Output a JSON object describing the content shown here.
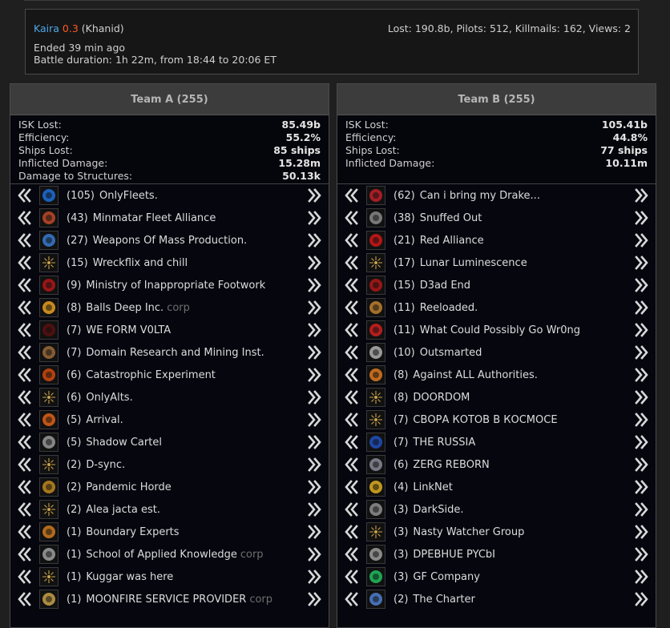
{
  "battle": {
    "system": "Kaira",
    "security": "0.3",
    "region": "(Khanid)",
    "stats": "Lost: 190.8b, Pilots: 512, Killmails: 162, Views: 2",
    "ended": "Ended 39 min ago",
    "duration": "Battle duration: 1h 22m,  from 18:44 to 20:06 ET"
  },
  "teams": [
    {
      "title": "Team A (255)",
      "stats": [
        {
          "label": "ISK Lost:",
          "value": "85.49b"
        },
        {
          "label": "Efficiency:",
          "value": "55.2%"
        },
        {
          "label": "Ships Lost:",
          "value": "85 ships"
        },
        {
          "label": "Inflicted Damage:",
          "value": "15.28m"
        },
        {
          "label": "Damage to Structures:",
          "value": "50.13k"
        }
      ],
      "alliances": [
        {
          "count": "(105)",
          "name": "OnlyFleets.",
          "icon": "onlyfleets-logo",
          "color": "#1e6fd9"
        },
        {
          "count": "(43)",
          "name": "Minmatar Fleet Alliance",
          "icon": "minmatar-logo",
          "color": "#c0492a"
        },
        {
          "count": "(27)",
          "name": "Weapons Of Mass Production.",
          "icon": "wmp-logo",
          "color": "#3a7bd0"
        },
        {
          "count": "(15)",
          "name": "Wreckflix and chill",
          "icon": "default-star-logo",
          "color": "#c9a24a"
        },
        {
          "count": "(9)",
          "name": "Ministry of Inappropriate Footwork",
          "icon": "ministry-logo",
          "color": "#b01818"
        },
        {
          "count": "(8)",
          "name": "Balls Deep Inc.",
          "corp": "corp",
          "icon": "scorpion-logo",
          "color": "#e8a020"
        },
        {
          "count": "(7)",
          "name": "WE FORM V0LTA",
          "icon": "volta-logo",
          "color": "#5a1010"
        },
        {
          "count": "(7)",
          "name": "Domain Research and Mining Inst.",
          "icon": "amarr-logo",
          "color": "#9a6a3a"
        },
        {
          "count": "(6)",
          "name": "Catastrophic Experiment",
          "icon": "catastrophic-logo",
          "color": "#d04a10"
        },
        {
          "count": "(6)",
          "name": "OnlyAlts.",
          "icon": "default-star-logo",
          "color": "#c9a24a"
        },
        {
          "count": "(5)",
          "name": "Arrival.",
          "icon": "arrival-logo",
          "color": "#e0601a"
        },
        {
          "count": "(5)",
          "name": "Shadow Cartel",
          "icon": "shadow-logo",
          "color": "#9a9a9a"
        },
        {
          "count": "(2)",
          "name": "D-sync.",
          "icon": "default-star-logo",
          "color": "#c9a24a"
        },
        {
          "count": "(2)",
          "name": "Pandemic Horde",
          "icon": "horde-logo",
          "color": "#c08a20"
        },
        {
          "count": "(2)",
          "name": "Alea jacta est.",
          "icon": "default-star-logo",
          "color": "#c9a24a"
        },
        {
          "count": "(1)",
          "name": "Boundary Experts",
          "icon": "boundary-logo",
          "color": "#d07a20"
        },
        {
          "count": "(1)",
          "name": "School of Applied Knowledge",
          "corp": "corp",
          "icon": "school-logo",
          "color": "#a0a0a0"
        },
        {
          "count": "(1)",
          "name": "Kuggar was here",
          "icon": "default-star-logo",
          "color": "#c9a24a"
        },
        {
          "count": "(1)",
          "name": "MOONFIRE SERVICE PROVIDER",
          "corp": "corp",
          "icon": "moonfire-logo",
          "color": "#c9a24a"
        }
      ]
    },
    {
      "title": "Team B (255)",
      "stats": [
        {
          "label": "ISK Lost:",
          "value": "105.41b"
        },
        {
          "label": "Efficiency:",
          "value": "44.8%"
        },
        {
          "label": "Ships Lost:",
          "value": "77 ships"
        },
        {
          "label": "Inflicted Damage:",
          "value": "10.11m"
        }
      ],
      "alliances": [
        {
          "count": "(62)",
          "name": "Can i bring my Drake...",
          "icon": "drake-logo",
          "color": "#c0202a"
        },
        {
          "count": "(38)",
          "name": "Snuffed Out",
          "icon": "snuffed-logo",
          "color": "#8a8a8a"
        },
        {
          "count": "(21)",
          "name": "Red Alliance",
          "icon": "red-alliance-logo",
          "color": "#d01818"
        },
        {
          "count": "(17)",
          "name": "Lunar Luminescence",
          "icon": "default-star-logo",
          "color": "#c9a24a"
        },
        {
          "count": "(15)",
          "name": "D3ad End",
          "icon": "d3ad-logo",
          "color": "#b01818"
        },
        {
          "count": "(11)",
          "name": "Reeloaded.",
          "icon": "reeloaded-logo",
          "color": "#c08030"
        },
        {
          "count": "(11)",
          "name": "What Could Possibly Go Wr0ng",
          "icon": "wcpgw-logo",
          "color": "#d02020"
        },
        {
          "count": "(10)",
          "name": "Outsmarted",
          "icon": "outsmarted-logo",
          "color": "#b0b0b0"
        },
        {
          "count": "(8)",
          "name": "Against ALL Authorities.",
          "icon": "aaa-logo",
          "color": "#e07a20"
        },
        {
          "count": "(8)",
          "name": "DOORDOM",
          "icon": "default-star-logo",
          "color": "#c9a24a"
        },
        {
          "count": "(7)",
          "name": "СВОРА КОТОВ В КОСМОСЕ",
          "icon": "default-star-logo",
          "color": "#c9a24a"
        },
        {
          "count": "(7)",
          "name": "THE RUSSIA",
          "icon": "russia-logo",
          "color": "#2050c0"
        },
        {
          "count": "(6)",
          "name": "ZERG REBORN",
          "icon": "zerg-logo",
          "color": "#8a8a9a"
        },
        {
          "count": "(4)",
          "name": "LinkNet",
          "icon": "linknet-logo",
          "color": "#e0b020"
        },
        {
          "count": "(3)",
          "name": "DarkSide.",
          "icon": "darkside-logo",
          "color": "#909090"
        },
        {
          "count": "(3)",
          "name": "Nasty Watcher Group",
          "icon": "default-star-logo",
          "color": "#c9a24a"
        },
        {
          "count": "(3)",
          "name": "DPEBHUE PYCbI",
          "icon": "dpebhue-logo",
          "color": "#a0a0a0"
        },
        {
          "count": "(3)",
          "name": "GF Company",
          "icon": "gf-logo",
          "color": "#20c060"
        },
        {
          "count": "(2)",
          "name": "The Charter",
          "icon": "charter-logo",
          "color": "#5080d0"
        }
      ]
    }
  ]
}
